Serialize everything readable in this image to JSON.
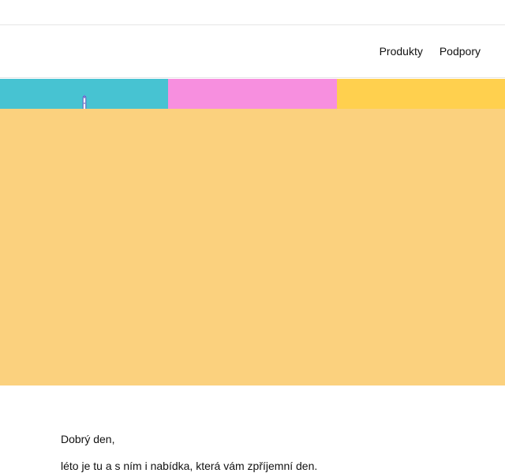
{
  "nav": {
    "items": [
      {
        "label": "Produkty"
      },
      {
        "label": "Podpory"
      }
    ]
  },
  "banner": {
    "tiles": [
      {
        "color": "#47c3d2",
        "icon": "electric-toothbrush-icon"
      },
      {
        "color": "#f78fdf",
        "icon": "kitchen-appliance-icon"
      },
      {
        "color": "#ffd04e",
        "icon": "jar-icon"
      }
    ],
    "overlay_color": "#fbd17e"
  },
  "content": {
    "greeting": "Dobrý den,",
    "intro": "léto je tu a s ním i nabídka, která vám zpříjemní den."
  }
}
